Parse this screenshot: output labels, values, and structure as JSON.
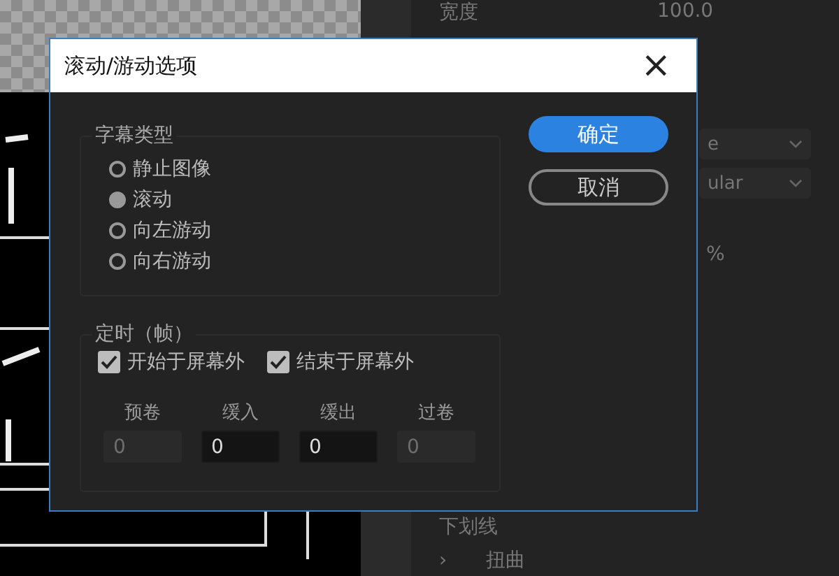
{
  "background": {
    "properties": [
      {
        "label": "宽度",
        "value": "100.0"
      }
    ],
    "dropdowns": [
      {
        "value": "e"
      },
      {
        "value": "ular"
      }
    ],
    "unit": "%",
    "effects": [
      {
        "label": "下划线",
        "kind": "plain"
      },
      {
        "label": "扭曲",
        "kind": "group",
        "expander": "›"
      }
    ]
  },
  "dialog": {
    "title": "滚动/游动选项",
    "close": "×",
    "title_type": {
      "legend": "字幕类型",
      "options": [
        {
          "label": "静止图像",
          "selected": false
        },
        {
          "label": "滚动",
          "selected": true
        },
        {
          "label": "向左游动",
          "selected": false
        },
        {
          "label": "向右游动",
          "selected": false
        }
      ]
    },
    "timing": {
      "legend": "定时（帧）",
      "checks": [
        {
          "label": "开始于屏幕外",
          "checked": true
        },
        {
          "label": "结束于屏幕外",
          "checked": true
        }
      ],
      "fields": [
        {
          "label": "预卷",
          "value": "0",
          "disabled": true
        },
        {
          "label": "缓入",
          "value": "0",
          "disabled": false
        },
        {
          "label": "缓出",
          "value": "0",
          "disabled": false
        },
        {
          "label": "过卷",
          "value": "0",
          "disabled": true
        }
      ]
    },
    "buttons": [
      {
        "label": "确定",
        "kind": "primary"
      },
      {
        "label": "取消",
        "kind": "secondary"
      }
    ]
  }
}
